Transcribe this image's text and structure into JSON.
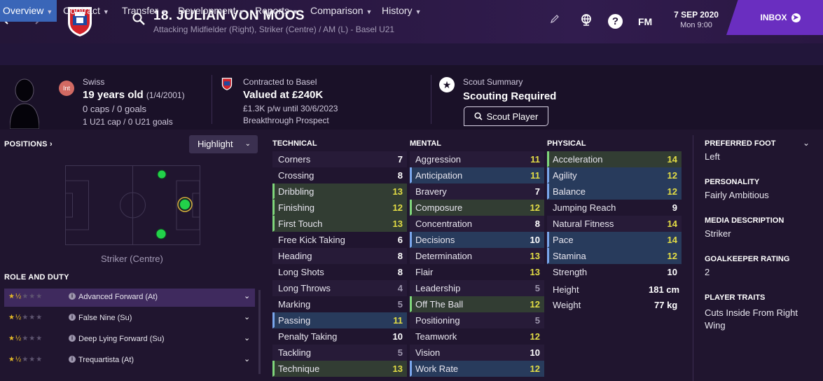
{
  "header": {
    "player_name": "18. JULIAN VON MOOS",
    "player_subtitle": "Attacking Midfielder (Right), Striker (Centre) / AM (L) - Basel U21",
    "fm_label": "FM",
    "date": "7 SEP 2020",
    "time": "Mon 9:00",
    "inbox_label": "INBOX",
    "help_glyph": "?"
  },
  "tabs": [
    {
      "label": "Overview"
    },
    {
      "label": "Contract"
    },
    {
      "label": "Transfer"
    },
    {
      "label": "Development"
    },
    {
      "label": "Reports"
    },
    {
      "label": "Comparison"
    },
    {
      "label": "History"
    }
  ],
  "info": {
    "badge": "Int",
    "nationality": "Swiss",
    "age": "19 years old",
    "dob": "(1/4/2001)",
    "caps": "0 caps / 0 goals",
    "u21_caps": "1 U21 cap / 0 U21 goals",
    "contract_title": "Contracted to Basel",
    "value": "Valued at £240K",
    "wage": "£1.3K p/w until 30/6/2023",
    "status": "Breakthrough Prospect",
    "scout_title": "Scout Summary",
    "scout_status": "Scouting Required",
    "scout_button": "Scout Player"
  },
  "positions": {
    "title": "POSITIONS",
    "highlight_label": "Highlight",
    "position_label": "Striker (Centre)"
  },
  "role_duty": {
    "title": "ROLE AND DUTY",
    "roles": [
      {
        "name": "Advanced Forward (At)",
        "stars": 1.5
      },
      {
        "name": "False Nine (Su)",
        "stars": 1.5
      },
      {
        "name": "Deep Lying Forward (Su)",
        "stars": 1.5
      },
      {
        "name": "Trequartista (At)",
        "stars": 1.5
      }
    ]
  },
  "technical": {
    "title": "TECHNICAL",
    "attrs": [
      {
        "name": "Corners",
        "value": "7",
        "hl": ""
      },
      {
        "name": "Crossing",
        "value": "8",
        "hl": ""
      },
      {
        "name": "Dribbling",
        "value": "13",
        "hl": "g"
      },
      {
        "name": "Finishing",
        "value": "12",
        "hl": "g"
      },
      {
        "name": "First Touch",
        "value": "13",
        "hl": "g"
      },
      {
        "name": "Free Kick Taking",
        "value": "6",
        "hl": ""
      },
      {
        "name": "Heading",
        "value": "8",
        "hl": ""
      },
      {
        "name": "Long Shots",
        "value": "8",
        "hl": ""
      },
      {
        "name": "Long Throws",
        "value": "4",
        "hl": ""
      },
      {
        "name": "Marking",
        "value": "5",
        "hl": ""
      },
      {
        "name": "Passing",
        "value": "11",
        "hl": "b"
      },
      {
        "name": "Penalty Taking",
        "value": "10",
        "hl": ""
      },
      {
        "name": "Tackling",
        "value": "5",
        "hl": ""
      },
      {
        "name": "Technique",
        "value": "13",
        "hl": "g"
      }
    ]
  },
  "mental": {
    "title": "MENTAL",
    "attrs": [
      {
        "name": "Aggression",
        "value": "11",
        "hl": ""
      },
      {
        "name": "Anticipation",
        "value": "11",
        "hl": "b"
      },
      {
        "name": "Bravery",
        "value": "7",
        "hl": ""
      },
      {
        "name": "Composure",
        "value": "12",
        "hl": "g"
      },
      {
        "name": "Concentration",
        "value": "8",
        "hl": ""
      },
      {
        "name": "Decisions",
        "value": "10",
        "hl": "b"
      },
      {
        "name": "Determination",
        "value": "13",
        "hl": ""
      },
      {
        "name": "Flair",
        "value": "13",
        "hl": ""
      },
      {
        "name": "Leadership",
        "value": "5",
        "hl": ""
      },
      {
        "name": "Off The Ball",
        "value": "12",
        "hl": "g"
      },
      {
        "name": "Positioning",
        "value": "5",
        "hl": ""
      },
      {
        "name": "Teamwork",
        "value": "12",
        "hl": ""
      },
      {
        "name": "Vision",
        "value": "10",
        "hl": ""
      },
      {
        "name": "Work Rate",
        "value": "12",
        "hl": "b"
      }
    ]
  },
  "physical": {
    "title": "PHYSICAL",
    "attrs": [
      {
        "name": "Acceleration",
        "value": "14",
        "hl": "g"
      },
      {
        "name": "Agility",
        "value": "12",
        "hl": "b"
      },
      {
        "name": "Balance",
        "value": "12",
        "hl": "b"
      },
      {
        "name": "Jumping Reach",
        "value": "9",
        "hl": ""
      },
      {
        "name": "Natural Fitness",
        "value": "14",
        "hl": ""
      },
      {
        "name": "Pace",
        "value": "14",
        "hl": "b"
      },
      {
        "name": "Stamina",
        "value": "12",
        "hl": "b"
      },
      {
        "name": "Strength",
        "value": "10",
        "hl": ""
      }
    ],
    "height_label": "Height",
    "height_value": "181 cm",
    "weight_label": "Weight",
    "weight_value": "77 kg"
  },
  "profile": {
    "preferred_foot_title": "PREFERRED FOOT",
    "preferred_foot": "Left",
    "personality_title": "PERSONALITY",
    "personality": "Fairly Ambitious",
    "media_title": "MEDIA DESCRIPTION",
    "media": "Striker",
    "gk_title": "GOALKEEPER RATING",
    "gk_rating": "2",
    "traits_title": "PLAYER TRAITS",
    "traits": "Cuts Inside From Right Wing"
  },
  "colors": {
    "accent_purple": "#6a2ec0",
    "active_tab": "#3a66b8",
    "attr_high": "#e3dd45",
    "pitch_dot": "#22d14a"
  }
}
